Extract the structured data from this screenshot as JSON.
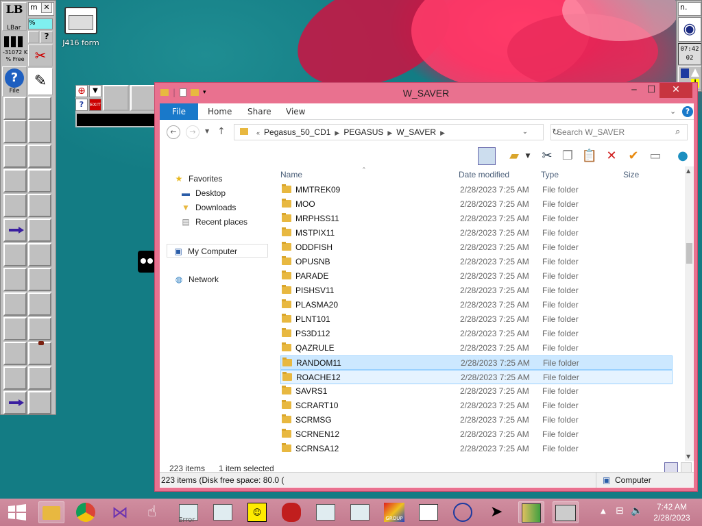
{
  "desktop": {
    "icon_label": "J416 form",
    "lbar": {
      "title": "LBar",
      "mem_value": "-31072 K",
      "mem_label": "% Free",
      "help_label": "File",
      "partial_caption": "m",
      "percent_glyph": "%"
    },
    "clock_widget": {
      "time": "07:42",
      "seconds": "02",
      "label": "n."
    }
  },
  "explorer": {
    "title": "W_SAVER",
    "ribbon_tabs": [
      "File",
      "Home",
      "Share",
      "View"
    ],
    "breadcrumb": [
      "Pegasus_50_CD1",
      "PEGASUS",
      "W_SAVER"
    ],
    "search_placeholder": "Search W_SAVER",
    "nav": {
      "favorites": "Favorites",
      "desktop": "Desktop",
      "downloads": "Downloads",
      "recent": "Recent places",
      "mycomputer": "My Computer",
      "network": "Network"
    },
    "columns": {
      "name": "Name",
      "date": "Date modified",
      "type": "Type",
      "size": "Size"
    },
    "files": [
      {
        "name": "MMTREK09",
        "date": "2/28/2023 7:25 AM",
        "type": "File folder"
      },
      {
        "name": "MOO",
        "date": "2/28/2023 7:25 AM",
        "type": "File folder"
      },
      {
        "name": "MRPHSS11",
        "date": "2/28/2023 7:25 AM",
        "type": "File folder"
      },
      {
        "name": "MSTPIX11",
        "date": "2/28/2023 7:25 AM",
        "type": "File folder"
      },
      {
        "name": "ODDFISH",
        "date": "2/28/2023 7:25 AM",
        "type": "File folder"
      },
      {
        "name": "OPUSNB",
        "date": "2/28/2023 7:25 AM",
        "type": "File folder"
      },
      {
        "name": "PARADE",
        "date": "2/28/2023 7:25 AM",
        "type": "File folder"
      },
      {
        "name": "PISHSV11",
        "date": "2/28/2023 7:25 AM",
        "type": "File folder"
      },
      {
        "name": "PLASMA20",
        "date": "2/28/2023 7:25 AM",
        "type": "File folder"
      },
      {
        "name": "PLNT101",
        "date": "2/28/2023 7:25 AM",
        "type": "File folder"
      },
      {
        "name": "PS3D112",
        "date": "2/28/2023 7:25 AM",
        "type": "File folder"
      },
      {
        "name": "QAZRULE",
        "date": "2/28/2023 7:25 AM",
        "type": "File folder"
      },
      {
        "name": "RANDOM11",
        "date": "2/28/2023 7:25 AM",
        "type": "File folder"
      },
      {
        "name": "ROACHE12",
        "date": "2/28/2023 7:25 AM",
        "type": "File folder"
      },
      {
        "name": "SAVRS1",
        "date": "2/28/2023 7:25 AM",
        "type": "File folder"
      },
      {
        "name": "SCRART10",
        "date": "2/28/2023 7:25 AM",
        "type": "File folder"
      },
      {
        "name": "SCRMSG",
        "date": "2/28/2023 7:25 AM",
        "type": "File folder"
      },
      {
        "name": "SCRNEN12",
        "date": "2/28/2023 7:25 AM",
        "type": "File folder"
      },
      {
        "name": "SCRNSA12",
        "date": "2/28/2023 7:25 AM",
        "type": "File folder"
      }
    ],
    "status": {
      "items": "223 items",
      "selected": "1 item selected"
    },
    "outer_status": {
      "disk": "223 items (Disk free space: 80.0 (",
      "location": "Computer"
    }
  },
  "taskbar": {
    "time": "7:42 AM",
    "date": "2/28/2023",
    "errortext": "Error",
    "group_label": "GROUP"
  }
}
